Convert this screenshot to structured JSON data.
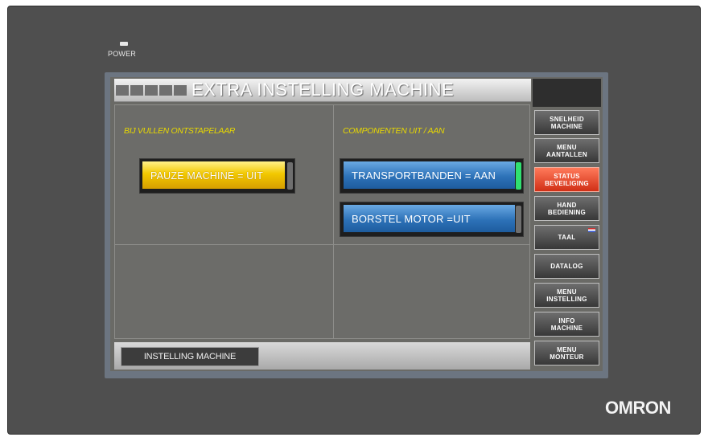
{
  "device": {
    "power_label": "POWER",
    "logo": "OMRON",
    "bezel_color": "#4f4f4f"
  },
  "screen": {
    "title": "EXTRA INSTELLING MACHINE",
    "left_section_label": "BIJ VULLEN ONTSTAPELAAR",
    "right_section_label": "COMPONENTEN  UIT / AAN",
    "buttons": {
      "pauze": {
        "label": "PAUZE MACHINE = UIT",
        "color": "#f2c800",
        "state": "uit"
      },
      "transport": {
        "label": "TRANSPORTBANDEN = AAN",
        "color": "#2d72b8",
        "indicator": "#30e070",
        "state": "aan"
      },
      "borstel": {
        "label": "BORSTEL MOTOR =UIT",
        "color": "#2d72b8",
        "indicator": "#6f6f6f",
        "state": "uit"
      }
    },
    "footer_button": "INSTELLING MACHINE"
  },
  "menu": [
    {
      "label": "SNELHEID\nMACHINE",
      "active": false
    },
    {
      "label": "MENU\nAANTALLEN",
      "active": false
    },
    {
      "label": "STATUS\nBEVEILIGING",
      "active": true
    },
    {
      "label": "HAND\nBEDIENING",
      "active": false
    },
    {
      "label": "TAAL",
      "active": false,
      "icon": "flag-icon"
    },
    {
      "label": "DATALOG",
      "active": false
    },
    {
      "label": "MENU\nINSTELLING",
      "active": false
    },
    {
      "label": "INFO\nMACHINE",
      "active": false
    },
    {
      "label": "MENU\nMONTEUR",
      "active": false
    }
  ],
  "colors": {
    "active_menu": "#d12f16",
    "section_label": "#e8d800"
  }
}
